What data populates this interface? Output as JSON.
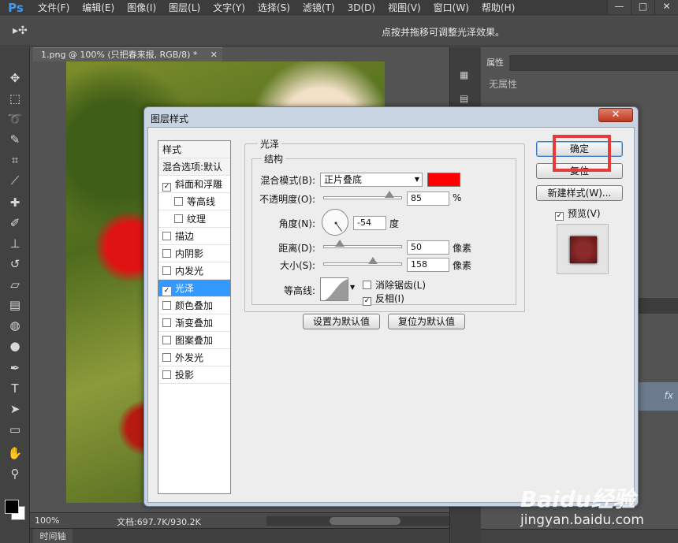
{
  "app": {
    "logo": "Ps",
    "menu": [
      "文件(F)",
      "编辑(E)",
      "图像(I)",
      "图层(L)",
      "文字(Y)",
      "选择(S)",
      "滤镜(T)",
      "3D(D)",
      "视图(V)",
      "窗口(W)",
      "帮助(H)"
    ],
    "window_controls": [
      "—",
      "□",
      "✕"
    ]
  },
  "options_bar": {
    "tool_glyph": "▸✣",
    "hint": "点按并拖移可调整光泽效果。"
  },
  "document": {
    "tab_label": "1.png @ 100% (只把春来报, RGB/8) *",
    "tab_close": "✕",
    "zoom": "100%",
    "doc_size": "文档:697.7K/930.2K"
  },
  "timeline": {
    "label": "时间轴"
  },
  "properties_panel": {
    "tab": "属性",
    "empty_text": "无属性"
  },
  "layers_panel": {
    "fx_label": "fx"
  },
  "dialog": {
    "title": "图层样式",
    "close_label": "✕",
    "style_list": {
      "header": "样式",
      "blend_default": "混合选项:默认",
      "items": [
        {
          "label": "斜面和浮雕",
          "checked": true,
          "indent": false
        },
        {
          "label": "等高线",
          "checked": false,
          "indent": true
        },
        {
          "label": "纹理",
          "checked": false,
          "indent": true
        },
        {
          "label": "描边",
          "checked": false,
          "indent": false
        },
        {
          "label": "内阴影",
          "checked": false,
          "indent": false
        },
        {
          "label": "内发光",
          "checked": false,
          "indent": false
        },
        {
          "label": "光泽",
          "checked": true,
          "indent": false,
          "selected": true
        },
        {
          "label": "颜色叠加",
          "checked": false,
          "indent": false
        },
        {
          "label": "渐变叠加",
          "checked": false,
          "indent": false
        },
        {
          "label": "图案叠加",
          "checked": false,
          "indent": false
        },
        {
          "label": "外发光",
          "checked": false,
          "indent": false
        },
        {
          "label": "投影",
          "checked": false,
          "indent": false
        }
      ]
    },
    "satin": {
      "group_title": "光泽",
      "structure_title": "结构",
      "blend_mode_label": "混合模式(B):",
      "blend_mode_value": "正片叠底",
      "blend_color": "#ff0000",
      "opacity_label": "不透明度(O):",
      "opacity_value": "85",
      "opacity_fraction": 0.85,
      "opacity_unit": "%",
      "angle_label": "角度(N):",
      "angle_value": "-54",
      "angle_unit": "度",
      "distance_label": "距离(D):",
      "distance_value": "50",
      "distance_fraction": 0.2,
      "distance_unit": "像素",
      "size_label": "大小(S):",
      "size_value": "158",
      "size_fraction": 0.63,
      "size_unit": "像素",
      "contour_label": "等高线:",
      "antialias_label": "消除锯齿(L)",
      "antialias_checked": false,
      "invert_label": "反相(I)",
      "invert_checked": true
    },
    "buttons": {
      "set_default": "设置为默认值",
      "reset_default": "复位为默认值",
      "ok": "确定",
      "reset": "复位",
      "new_style": "新建样式(W)...",
      "preview_label": "预览(V)",
      "preview_checked": true
    }
  },
  "watermark": {
    "main": "Baidu经验",
    "sub": "jingyan.baidu.com"
  },
  "colors": {
    "accent_selected": "#3399ff",
    "highlight": "#e53b3b"
  }
}
